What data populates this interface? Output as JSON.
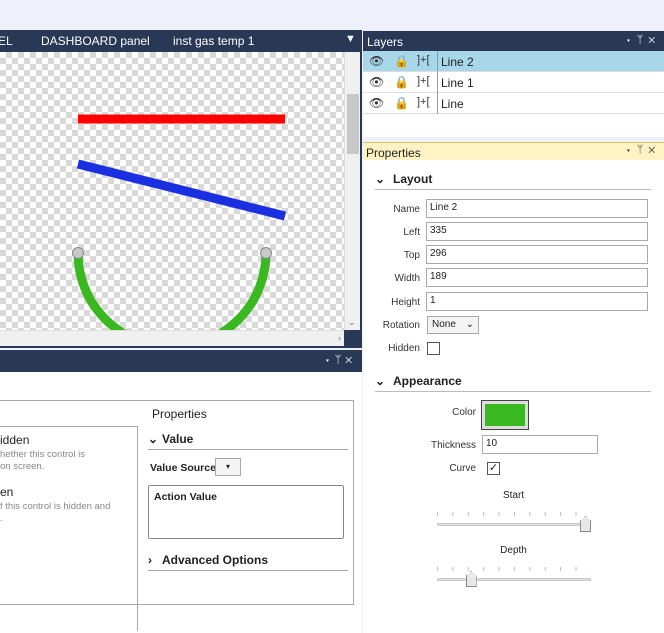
{
  "tabs": [
    {
      "label": "EL"
    },
    {
      "label": "DASHBOARD panel"
    },
    {
      "label": "inst gas temp 1"
    }
  ],
  "tab_menu_icon": "dropdown-arrow-icon",
  "canvas": {
    "lines": [
      {
        "name": "red-line",
        "color": "#ff0000"
      },
      {
        "name": "blue-line",
        "color": "#1a2fe0"
      },
      {
        "name": "green-curve",
        "color": "#3ab81f"
      }
    ]
  },
  "layers": {
    "title": "Layers",
    "items": [
      {
        "name": "Line 2",
        "selected": true
      },
      {
        "name": "Line 1",
        "selected": false
      },
      {
        "name": "Line",
        "selected": false
      }
    ]
  },
  "properties": {
    "title": "Properties",
    "layout": {
      "heading": "Layout",
      "name_label": "Name",
      "name_value": "Line 2",
      "left_label": "Left",
      "left_value": "335",
      "top_label": "Top",
      "top_value": "296",
      "width_label": "Width",
      "width_value": "189",
      "height_label": "Height",
      "height_value": "1",
      "rotation_label": "Rotation",
      "rotation_value": "None",
      "hidden_label": "Hidden"
    },
    "appearance": {
      "heading": "Appearance",
      "color_label": "Color",
      "color_value": "#3ab81f",
      "thickness_label": "Thickness",
      "thickness_value": "10",
      "curve_label": "Curve",
      "curve_checked": "✓",
      "start_label": "Start",
      "start_level": 1.0,
      "depth_label": "Depth",
      "depth_level": 0.2
    }
  },
  "bottom_panel": {
    "properties_title": "Properties",
    "items": [
      {
        "title": "idden",
        "desc": "hether this control is\non screen."
      },
      {
        "title": "en",
        "desc": "f this control is hidden and\n."
      }
    ],
    "value_heading": "Value",
    "value_source_label": "Value Source",
    "action_value_label": "Action Value",
    "advanced_heading": "Advanced Options"
  }
}
